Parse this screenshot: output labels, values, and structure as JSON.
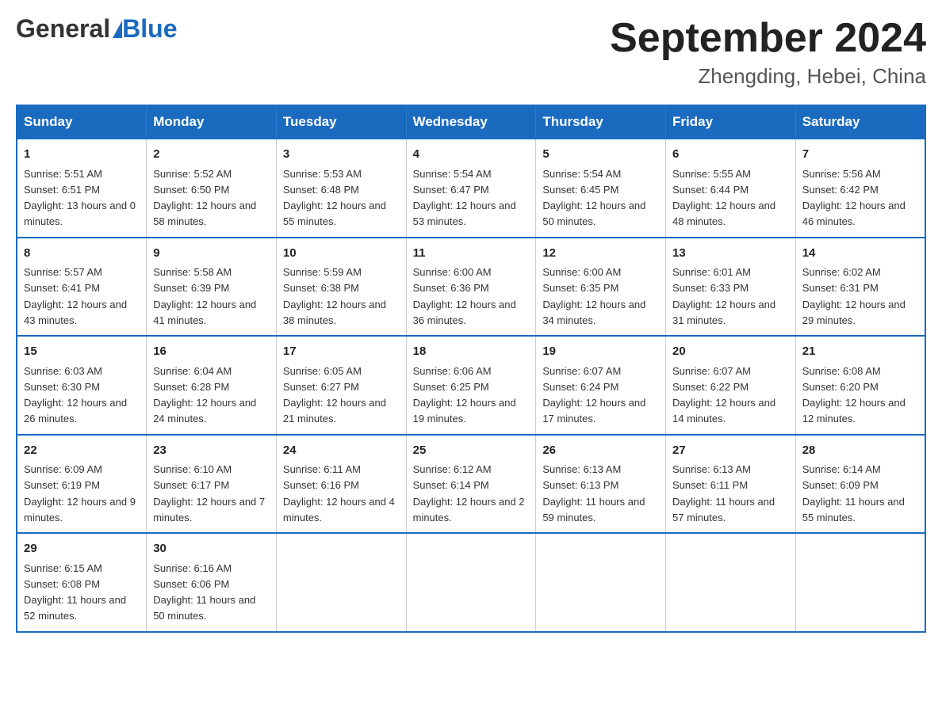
{
  "header": {
    "logo_general": "General",
    "logo_blue": "Blue",
    "month_title": "September 2024",
    "location": "Zhengding, Hebei, China"
  },
  "days_of_week": [
    "Sunday",
    "Monday",
    "Tuesday",
    "Wednesday",
    "Thursday",
    "Friday",
    "Saturday"
  ],
  "weeks": [
    [
      {
        "day": "1",
        "sunrise": "5:51 AM",
        "sunset": "6:51 PM",
        "daylight": "13 hours and 0 minutes."
      },
      {
        "day": "2",
        "sunrise": "5:52 AM",
        "sunset": "6:50 PM",
        "daylight": "12 hours and 58 minutes."
      },
      {
        "day": "3",
        "sunrise": "5:53 AM",
        "sunset": "6:48 PM",
        "daylight": "12 hours and 55 minutes."
      },
      {
        "day": "4",
        "sunrise": "5:54 AM",
        "sunset": "6:47 PM",
        "daylight": "12 hours and 53 minutes."
      },
      {
        "day": "5",
        "sunrise": "5:54 AM",
        "sunset": "6:45 PM",
        "daylight": "12 hours and 50 minutes."
      },
      {
        "day": "6",
        "sunrise": "5:55 AM",
        "sunset": "6:44 PM",
        "daylight": "12 hours and 48 minutes."
      },
      {
        "day": "7",
        "sunrise": "5:56 AM",
        "sunset": "6:42 PM",
        "daylight": "12 hours and 46 minutes."
      }
    ],
    [
      {
        "day": "8",
        "sunrise": "5:57 AM",
        "sunset": "6:41 PM",
        "daylight": "12 hours and 43 minutes."
      },
      {
        "day": "9",
        "sunrise": "5:58 AM",
        "sunset": "6:39 PM",
        "daylight": "12 hours and 41 minutes."
      },
      {
        "day": "10",
        "sunrise": "5:59 AM",
        "sunset": "6:38 PM",
        "daylight": "12 hours and 38 minutes."
      },
      {
        "day": "11",
        "sunrise": "6:00 AM",
        "sunset": "6:36 PM",
        "daylight": "12 hours and 36 minutes."
      },
      {
        "day": "12",
        "sunrise": "6:00 AM",
        "sunset": "6:35 PM",
        "daylight": "12 hours and 34 minutes."
      },
      {
        "day": "13",
        "sunrise": "6:01 AM",
        "sunset": "6:33 PM",
        "daylight": "12 hours and 31 minutes."
      },
      {
        "day": "14",
        "sunrise": "6:02 AM",
        "sunset": "6:31 PM",
        "daylight": "12 hours and 29 minutes."
      }
    ],
    [
      {
        "day": "15",
        "sunrise": "6:03 AM",
        "sunset": "6:30 PM",
        "daylight": "12 hours and 26 minutes."
      },
      {
        "day": "16",
        "sunrise": "6:04 AM",
        "sunset": "6:28 PM",
        "daylight": "12 hours and 24 minutes."
      },
      {
        "day": "17",
        "sunrise": "6:05 AM",
        "sunset": "6:27 PM",
        "daylight": "12 hours and 21 minutes."
      },
      {
        "day": "18",
        "sunrise": "6:06 AM",
        "sunset": "6:25 PM",
        "daylight": "12 hours and 19 minutes."
      },
      {
        "day": "19",
        "sunrise": "6:07 AM",
        "sunset": "6:24 PM",
        "daylight": "12 hours and 17 minutes."
      },
      {
        "day": "20",
        "sunrise": "6:07 AM",
        "sunset": "6:22 PM",
        "daylight": "12 hours and 14 minutes."
      },
      {
        "day": "21",
        "sunrise": "6:08 AM",
        "sunset": "6:20 PM",
        "daylight": "12 hours and 12 minutes."
      }
    ],
    [
      {
        "day": "22",
        "sunrise": "6:09 AM",
        "sunset": "6:19 PM",
        "daylight": "12 hours and 9 minutes."
      },
      {
        "day": "23",
        "sunrise": "6:10 AM",
        "sunset": "6:17 PM",
        "daylight": "12 hours and 7 minutes."
      },
      {
        "day": "24",
        "sunrise": "6:11 AM",
        "sunset": "6:16 PM",
        "daylight": "12 hours and 4 minutes."
      },
      {
        "day": "25",
        "sunrise": "6:12 AM",
        "sunset": "6:14 PM",
        "daylight": "12 hours and 2 minutes."
      },
      {
        "day": "26",
        "sunrise": "6:13 AM",
        "sunset": "6:13 PM",
        "daylight": "11 hours and 59 minutes."
      },
      {
        "day": "27",
        "sunrise": "6:13 AM",
        "sunset": "6:11 PM",
        "daylight": "11 hours and 57 minutes."
      },
      {
        "day": "28",
        "sunrise": "6:14 AM",
        "sunset": "6:09 PM",
        "daylight": "11 hours and 55 minutes."
      }
    ],
    [
      {
        "day": "29",
        "sunrise": "6:15 AM",
        "sunset": "6:08 PM",
        "daylight": "11 hours and 52 minutes."
      },
      {
        "day": "30",
        "sunrise": "6:16 AM",
        "sunset": "6:06 PM",
        "daylight": "11 hours and 50 minutes."
      },
      null,
      null,
      null,
      null,
      null
    ]
  ]
}
